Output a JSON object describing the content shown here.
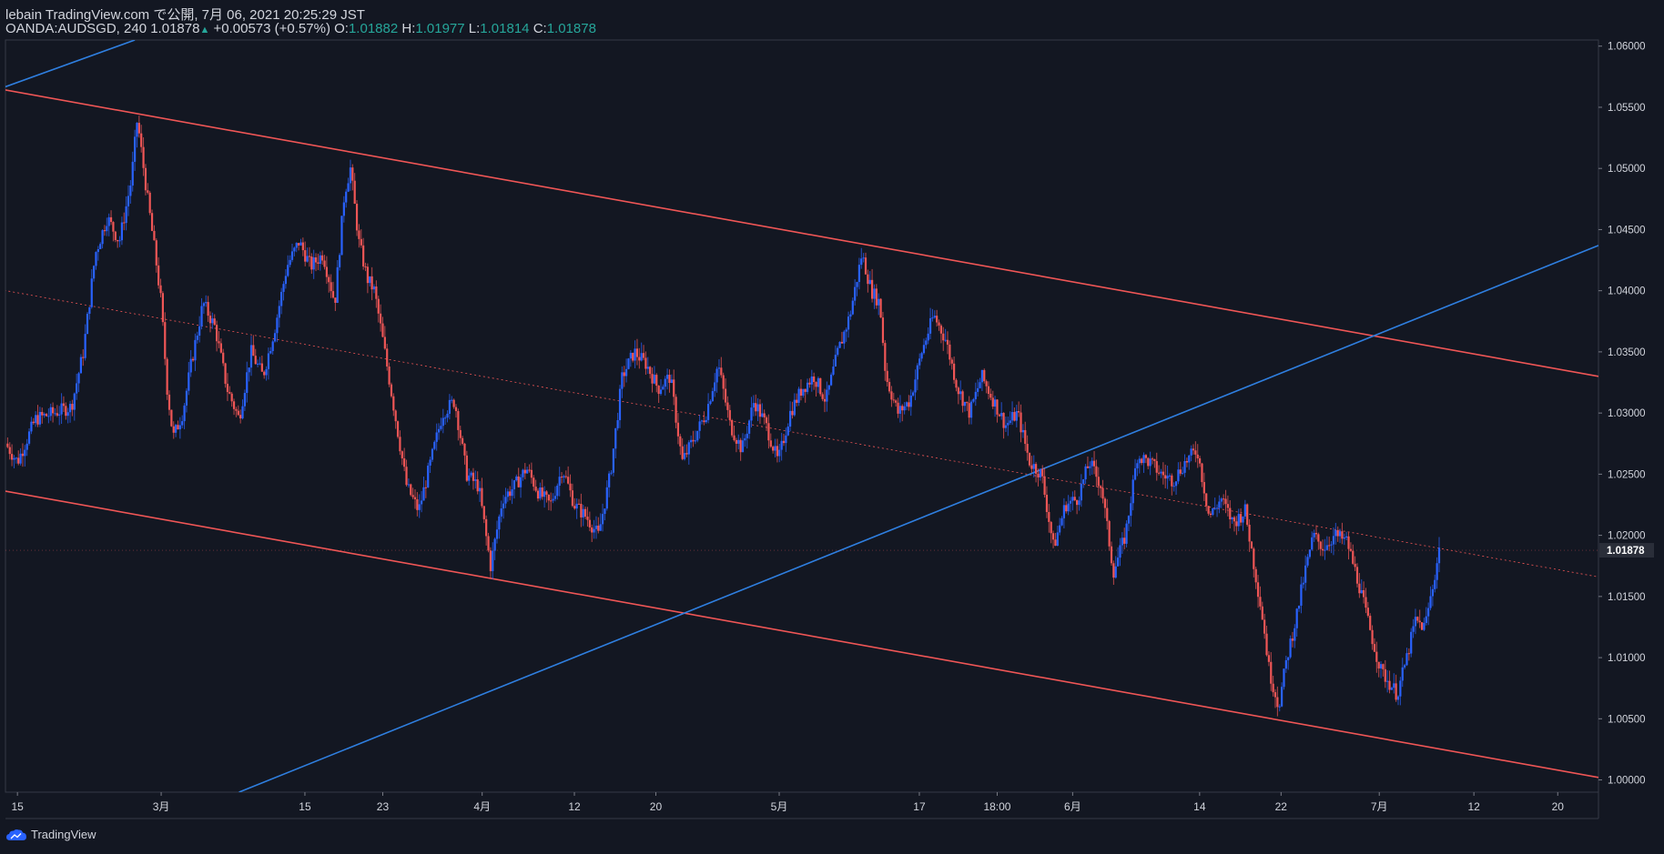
{
  "header": {
    "line1": "lebain TradingView.com で公開, 7月 06, 2021 20:25:29 JST",
    "symbol": "OANDA:AUDSGD, 240",
    "last": "1.01878",
    "change": "+0.00573 (+0.57%)",
    "o_label": "O:",
    "o_value": "1.01882",
    "h_label": "H:",
    "h_value": "1.01977",
    "l_label": "L:",
    "l_value": "1.01814",
    "c_label": "C:",
    "c_value": "1.01878"
  },
  "footer": {
    "brand": "TradingView",
    "icon": "tradingview-cloud-icon"
  },
  "colors": {
    "background": "#131722",
    "up_candle": "#2962ff",
    "down_candle": "#f05656",
    "channel_line": "#f05656",
    "trend_line": "#2f7fe0",
    "text": "#d1d4dc",
    "ohlc_value": "#26a69a"
  },
  "chart_data": {
    "type": "candlestick",
    "y_range": [
      0.999,
      1.0605
    ],
    "y_ticks": [
      "1.06000",
      "1.05500",
      "1.05000",
      "1.04500",
      "1.04000",
      "1.03500",
      "1.03000",
      "1.02500",
      "1.02000",
      "1.01500",
      "1.01000",
      "1.00500",
      "1.00000"
    ],
    "y_tick_values": [
      1.06,
      1.055,
      1.05,
      1.045,
      1.04,
      1.035,
      1.03,
      1.025,
      1.02,
      1.015,
      1.01,
      1.005,
      1.0
    ],
    "last_price": 1.01878,
    "last_price_label": "1.01878",
    "x_range_days": [
      0,
      133
    ],
    "x_ticks": [
      {
        "label": "15",
        "day": 1
      },
      {
        "label": "3月",
        "day": 13
      },
      {
        "label": "15",
        "day": 25
      },
      {
        "label": "23",
        "day": 31.5
      },
      {
        "label": "4月",
        "day": 39.8
      },
      {
        "label": "12",
        "day": 47.5
      },
      {
        "label": "20",
        "day": 54.3
      },
      {
        "label": "5月",
        "day": 64.6
      },
      {
        "label": "17",
        "day": 76.3
      },
      {
        "label": "18:00",
        "day": 82.8
      },
      {
        "label": "6月",
        "day": 89.1
      },
      {
        "label": "14",
        "day": 99.7
      },
      {
        "label": "22",
        "day": 106.5
      },
      {
        "label": "7月",
        "day": 114.7
      },
      {
        "label": "12",
        "day": 122.6
      },
      {
        "label": "20",
        "day": 129.6
      }
    ],
    "price_path": [
      [
        0,
        1.0275
      ],
      [
        1,
        1.026
      ],
      [
        2.5,
        1.0295
      ],
      [
        4,
        1.03
      ],
      [
        5.5,
        1.0305
      ],
      [
        6.5,
        1.035
      ],
      [
        7.5,
        1.043
      ],
      [
        8.5,
        1.046
      ],
      [
        9.5,
        1.044
      ],
      [
        10.5,
        1.049
      ],
      [
        11,
        1.054
      ],
      [
        11.8,
        1.048
      ],
      [
        12.5,
        1.043
      ],
      [
        13,
        1.039
      ],
      [
        13.5,
        1.032
      ],
      [
        14,
        1.028
      ],
      [
        14.8,
        1.03
      ],
      [
        15.5,
        1.034
      ],
      [
        16.5,
        1.039
      ],
      [
        17.5,
        1.037
      ],
      [
        18.5,
        1.032
      ],
      [
        19.5,
        1.0295
      ],
      [
        20.5,
        1.035
      ],
      [
        21.5,
        1.033
      ],
      [
        22.5,
        1.037
      ],
      [
        23.5,
        1.042
      ],
      [
        24.5,
        1.044
      ],
      [
        25.5,
        1.042
      ],
      [
        26.5,
        1.043
      ],
      [
        27.5,
        1.039
      ],
      [
        28.3,
        1.048
      ],
      [
        28.8,
        1.05
      ],
      [
        29.5,
        1.044
      ],
      [
        30.2,
        1.041
      ],
      [
        30.8,
        1.04
      ],
      [
        31.5,
        1.036
      ],
      [
        32.5,
        1.03
      ],
      [
        33.5,
        1.024
      ],
      [
        34.5,
        1.022
      ],
      [
        35.5,
        1.026
      ],
      [
        36.5,
        1.03
      ],
      [
        37.5,
        1.031
      ],
      [
        38.5,
        1.025
      ],
      [
        39.5,
        1.024
      ],
      [
        40.5,
        1.0175
      ],
      [
        41.5,
        1.023
      ],
      [
        42.5,
        1.024
      ],
      [
        43.5,
        1.0255
      ],
      [
        44.5,
        1.0235
      ],
      [
        45.5,
        1.0225
      ],
      [
        46.5,
        1.0255
      ],
      [
        47.5,
        1.0225
      ],
      [
        48.5,
        1.0215
      ],
      [
        49.5,
        1.02
      ],
      [
        50.5,
        1.025
      ],
      [
        51.5,
        1.033
      ],
      [
        52.5,
        1.035
      ],
      [
        53.5,
        1.034
      ],
      [
        54.5,
        1.032
      ],
      [
        55.5,
        1.033
      ],
      [
        56.5,
        1.026
      ],
      [
        57.5,
        1.028
      ],
      [
        58.5,
        1.03
      ],
      [
        59.5,
        1.034
      ],
      [
        60.5,
        1.029
      ],
      [
        61.5,
        1.027
      ],
      [
        62.5,
        1.031
      ],
      [
        63.5,
        1.029
      ],
      [
        64.5,
        1.026
      ],
      [
        65.5,
        1.03
      ],
      [
        66.5,
        1.032
      ],
      [
        67.5,
        1.033
      ],
      [
        68.5,
        1.031
      ],
      [
        69.5,
        1.035
      ],
      [
        70.5,
        1.038
      ],
      [
        71.5,
        1.043
      ],
      [
        72.3,
        1.04
      ],
      [
        73,
        1.039
      ],
      [
        73.5,
        1.033
      ],
      [
        74.5,
        1.03
      ],
      [
        75.5,
        1.031
      ],
      [
        76.5,
        1.035
      ],
      [
        77.5,
        1.038
      ],
      [
        78.5,
        1.036
      ],
      [
        79.5,
        1.032
      ],
      [
        80.5,
        1.03
      ],
      [
        81.5,
        1.033
      ],
      [
        82.5,
        1.031
      ],
      [
        83.5,
        1.029
      ],
      [
        84.5,
        1.03
      ],
      [
        85.5,
        1.026
      ],
      [
        86.5,
        1.025
      ],
      [
        87.5,
        1.019
      ],
      [
        88.5,
        1.0225
      ],
      [
        89.5,
        1.023
      ],
      [
        90.5,
        1.026
      ],
      [
        91.5,
        1.024
      ],
      [
        92.5,
        1.017
      ],
      [
        93.5,
        1.02
      ],
      [
        94.5,
        1.0265
      ],
      [
        95.5,
        1.026
      ],
      [
        96.5,
        1.025
      ],
      [
        97.5,
        1.0245
      ],
      [
        98.5,
        1.026
      ],
      [
        99.5,
        1.027
      ],
      [
        100.5,
        1.0215
      ],
      [
        101.5,
        1.023
      ],
      [
        102.5,
        1.021
      ],
      [
        103.5,
        1.022
      ],
      [
        104.5,
        1.016
      ],
      [
        105,
        1.013
      ],
      [
        105.5,
        1.009
      ],
      [
        106.3,
        1.006
      ],
      [
        107,
        1.01
      ],
      [
        107.7,
        1.013
      ],
      [
        108.5,
        1.017
      ],
      [
        109.2,
        1.02
      ],
      [
        110,
        1.019
      ],
      [
        111,
        1.02
      ],
      [
        112,
        1.0195
      ],
      [
        113,
        1.016
      ],
      [
        114,
        1.012
      ],
      [
        114.8,
        1.009
      ],
      [
        115.5,
        1.008
      ],
      [
        116.2,
        1.007
      ],
      [
        117,
        1.01
      ],
      [
        117.7,
        1.013
      ],
      [
        118.5,
        1.0125
      ],
      [
        119.2,
        1.016
      ],
      [
        119.7,
        1.0188
      ]
    ],
    "channel_upper": [
      [
        -0.5,
        1.0565
      ],
      [
        133,
        1.033
      ]
    ],
    "channel_lower": [
      [
        -0.5,
        1.0237
      ],
      [
        133,
        1.0002
      ]
    ],
    "channel_median": [
      [
        -0.5,
        1.0401
      ],
      [
        133,
        1.0166
      ]
    ],
    "trend_line": [
      [
        19.5,
        0.999
      ],
      [
        133,
        1.0437
      ]
    ],
    "trend_line_2": [
      [
        -0.5,
        1.0565
      ],
      [
        10.8,
        1.0605
      ]
    ]
  }
}
